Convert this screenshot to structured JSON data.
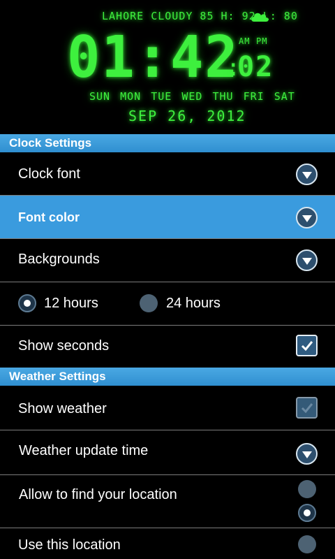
{
  "clock": {
    "weather_text": "LAHORE CLOUDY 85 H: 92 L: 80",
    "hours_minutes": "01:42",
    "am_label": "AM",
    "pm_label": "PM",
    "seconds_colon": ":",
    "seconds": "02",
    "days": "SUN MON TUE WED THU FRI SAT",
    "date": "SEP 26, 2012",
    "color": "#3ef03e"
  },
  "clock_settings": {
    "header": "Clock Settings",
    "clock_font_label": "Clock font",
    "font_color_label": "Font color",
    "backgrounds_label": "Backgrounds",
    "hours_12_label": "12 hours",
    "hours_24_label": "24 hours",
    "show_seconds_label": "Show seconds"
  },
  "weather_settings": {
    "header": "Weather Settings",
    "show_weather_label": "Show weather",
    "update_time_label": "Weather update time",
    "allow_location_label": "Allow to find your location",
    "use_location_label": "Use this location"
  },
  "colors": {
    "accent": "#3a9bde",
    "header_blue": "#2f8fd0",
    "lcd_green": "#3ef03e"
  }
}
